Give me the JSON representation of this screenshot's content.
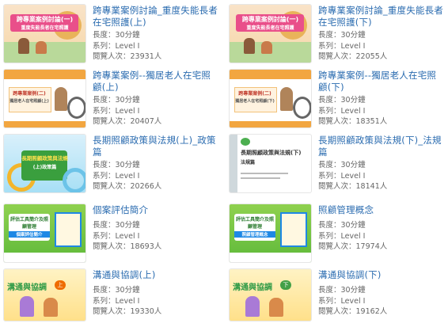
{
  "labels": {
    "length": "長度：",
    "series": "系列：",
    "views": "閱覽人次："
  },
  "courses": [
    {
      "title": "跨專業案例討論_重度失能長者在宅照護(上)",
      "length": "30分鐘",
      "series": "Level I",
      "views": "23931人",
      "thumb_text": "跨專業案例討論(一)",
      "thumb_sub": "重度失能長者在宅照護",
      "badge": "上"
    },
    {
      "title": "跨專業案例討論_重度失能長者在宅照護(下)",
      "length": "30分鐘",
      "series": "Level I",
      "views": "22055人",
      "thumb_text": "跨專業案例討論(一)",
      "thumb_sub": "重度失能長者在宅照護",
      "badge": "下"
    },
    {
      "title": "跨專業案例--獨居老人在宅照顧(上)",
      "length": "30分鐘",
      "series": "Level I",
      "views": "20407人",
      "thumb_text": "跨專業案例(二)",
      "thumb_sub": "獨居老人在宅照顧(上)",
      "badge": ""
    },
    {
      "title": "跨專業案例--獨居老人在宅照顧(下)",
      "length": "30分鐘",
      "series": "Level I",
      "views": "18351人",
      "thumb_text": "跨專業案例(二)",
      "thumb_sub": "獨居老人在宅照顧(下)",
      "badge": ""
    },
    {
      "title": "長期照顧政策與法規(上)_政策篇",
      "length": "30分鐘",
      "series": "Level I",
      "views": "20266人",
      "thumb_text": "長期照顧政策與法規",
      "thumb_sub": "(上)政策篇",
      "badge": ""
    },
    {
      "title": "長期照顧政策與法規(下)_法規篇",
      "length": "30分鐘",
      "series": "Level I",
      "views": "18141人",
      "thumb_text": "長期照顧政策與法規(下)",
      "thumb_sub": "法規篇",
      "badge": ""
    },
    {
      "title": "個案評估簡介",
      "length": "30分鐘",
      "series": "Level I",
      "views": "18693人",
      "thumb_text": "評估工具簡介及照顧管理",
      "thumb_sub": "個案評估簡介",
      "badge": ""
    },
    {
      "title": "照顧管理概念",
      "length": "30分鐘",
      "series": "Level I",
      "views": "17974人",
      "thumb_text": "評估工具簡介及照顧管理",
      "thumb_sub": "照顧管理概念",
      "badge": ""
    },
    {
      "title": "溝通與協調(上)",
      "length": "30分鐘",
      "series": "Level I",
      "views": "19330人",
      "thumb_text": "溝通與協調",
      "thumb_sub": "",
      "badge": "上"
    },
    {
      "title": "溝通與協調(下)",
      "length": "30分鐘",
      "series": "Level I",
      "views": "19162人",
      "thumb_text": "溝通與協調",
      "thumb_sub": "",
      "badge": "下"
    }
  ]
}
